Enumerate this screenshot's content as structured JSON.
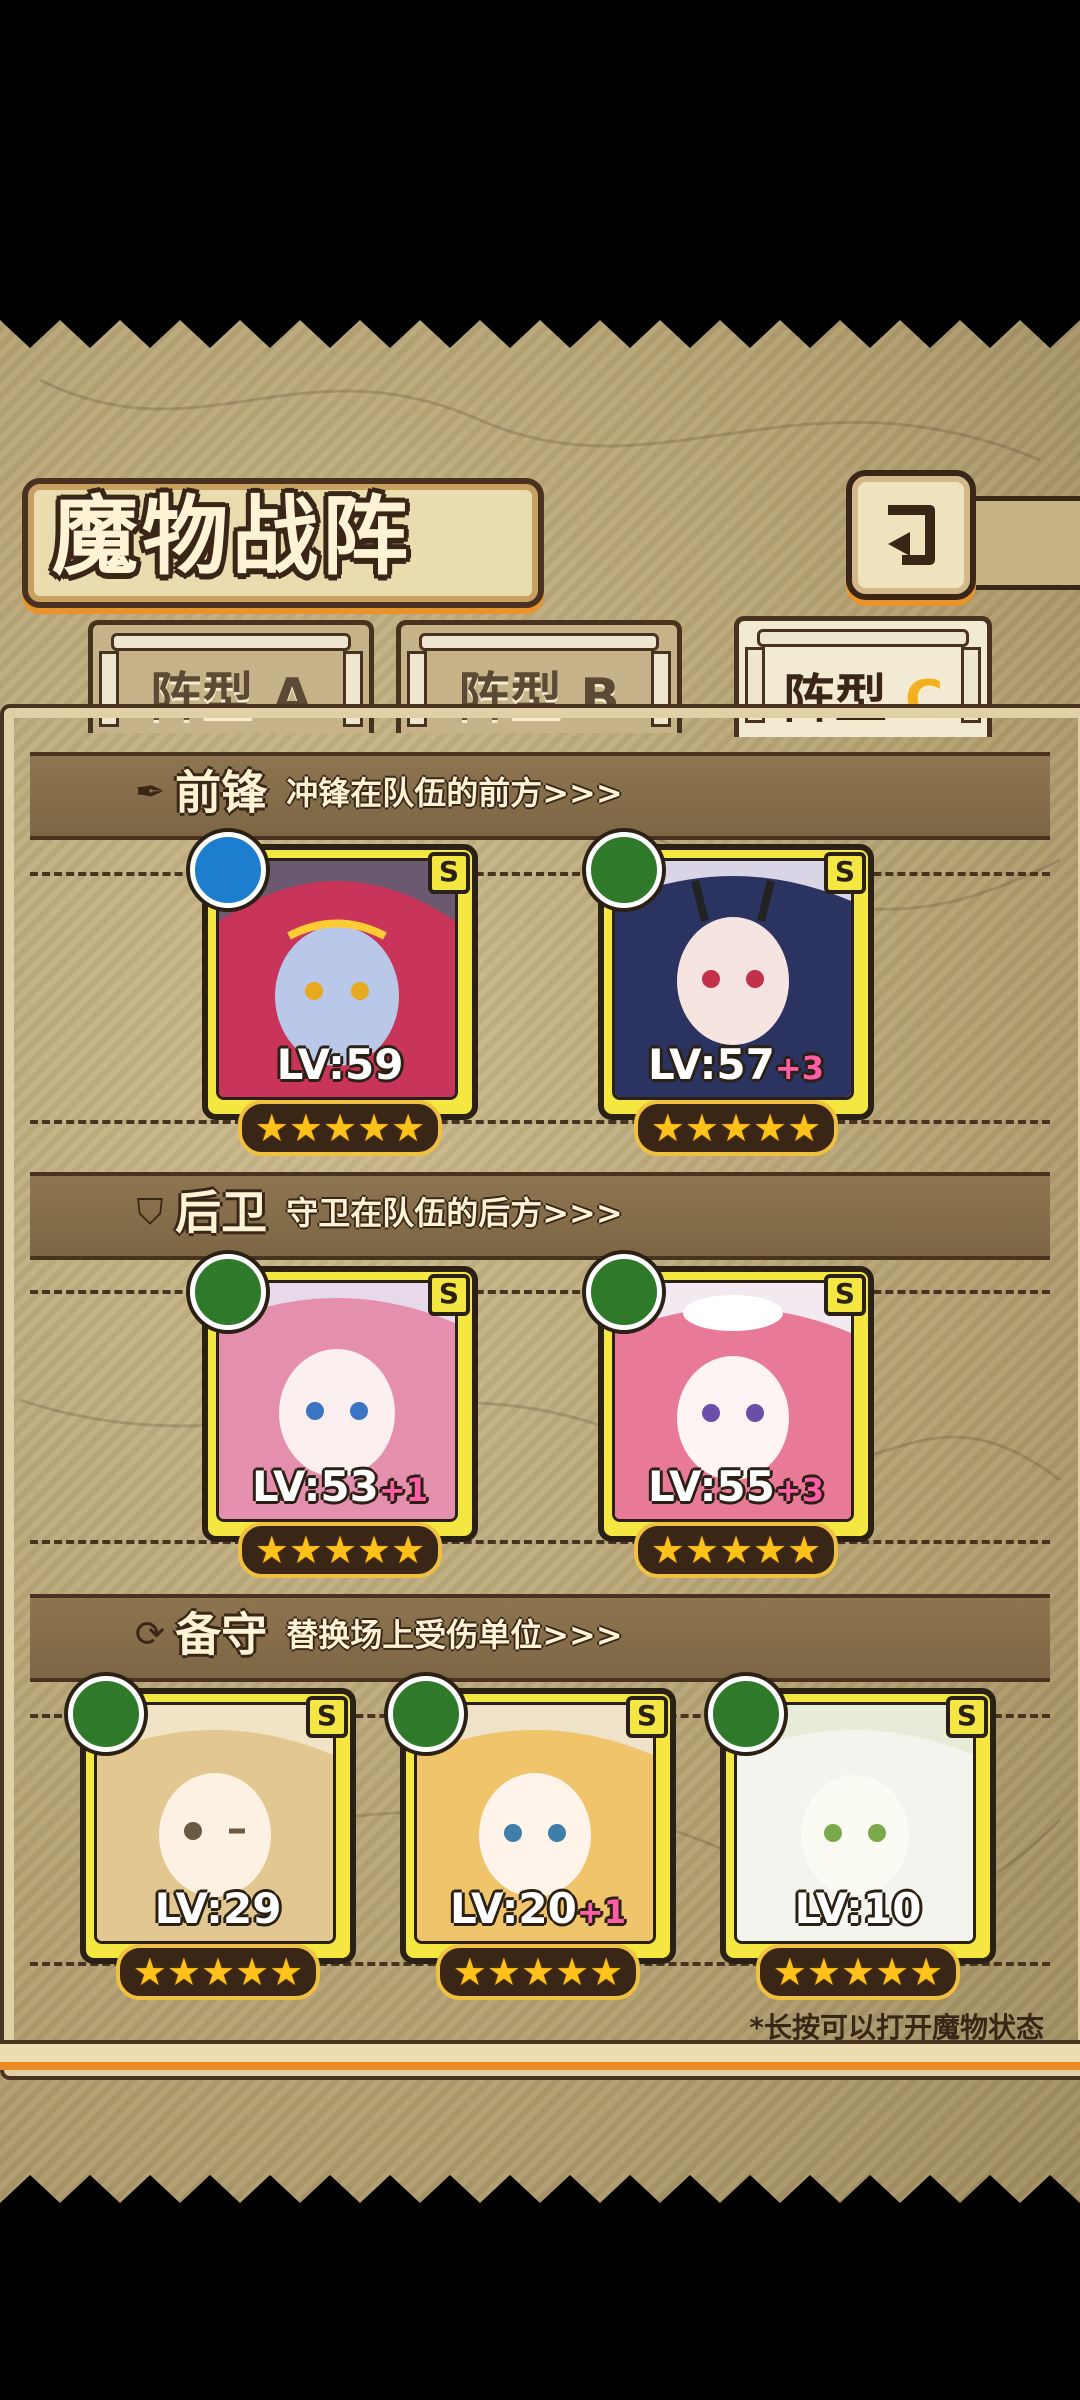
{
  "screen": {
    "title": "魔物战阵"
  },
  "tabs": [
    {
      "label": "阵型",
      "letter": "A",
      "active": false
    },
    {
      "label": "阵型",
      "letter": "B",
      "active": false
    },
    {
      "label": "阵型",
      "letter": "C",
      "active": true
    }
  ],
  "sections": {
    "front": {
      "title": "前锋",
      "desc": "冲锋在队伍的前方>>>",
      "icon": "sword-icon"
    },
    "rear": {
      "title": "后卫",
      "desc": "守卫在队伍的后方>>>",
      "icon": "shield-icon"
    },
    "reserve": {
      "title": "备守",
      "desc": "替换场上受伤单位>>>",
      "icon": "swap-icon"
    }
  },
  "units": {
    "front": [
      {
        "lv": "LV:59",
        "plus": "",
        "element": "water",
        "rank": "S",
        "stars": 5
      },
      {
        "lv": "LV:57",
        "plus": "+3",
        "element": "leaf",
        "rank": "S",
        "stars": 5
      }
    ],
    "rear": [
      {
        "lv": "LV:53",
        "plus": "+1",
        "element": "leaf",
        "rank": "S",
        "stars": 5
      },
      {
        "lv": "LV:55",
        "plus": "+3",
        "element": "leaf",
        "rank": "S",
        "stars": 5
      }
    ],
    "reserve": [
      {
        "lv": "LV:29",
        "plus": "",
        "element": "leaf",
        "rank": "S",
        "stars": 5
      },
      {
        "lv": "LV:20",
        "plus": "+1",
        "element": "leaf",
        "rank": "S",
        "stars": 5
      },
      {
        "lv": "LV:10",
        "plus": "",
        "element": "leaf",
        "rank": "S",
        "stars": 5
      }
    ]
  },
  "footnote": "*长按可以打开魔物状态",
  "colors": {
    "accent": "#f4e742",
    "frame": "#2a2014",
    "tab_letter_active": "#f2b01e",
    "plus": "#ff5ea6"
  }
}
